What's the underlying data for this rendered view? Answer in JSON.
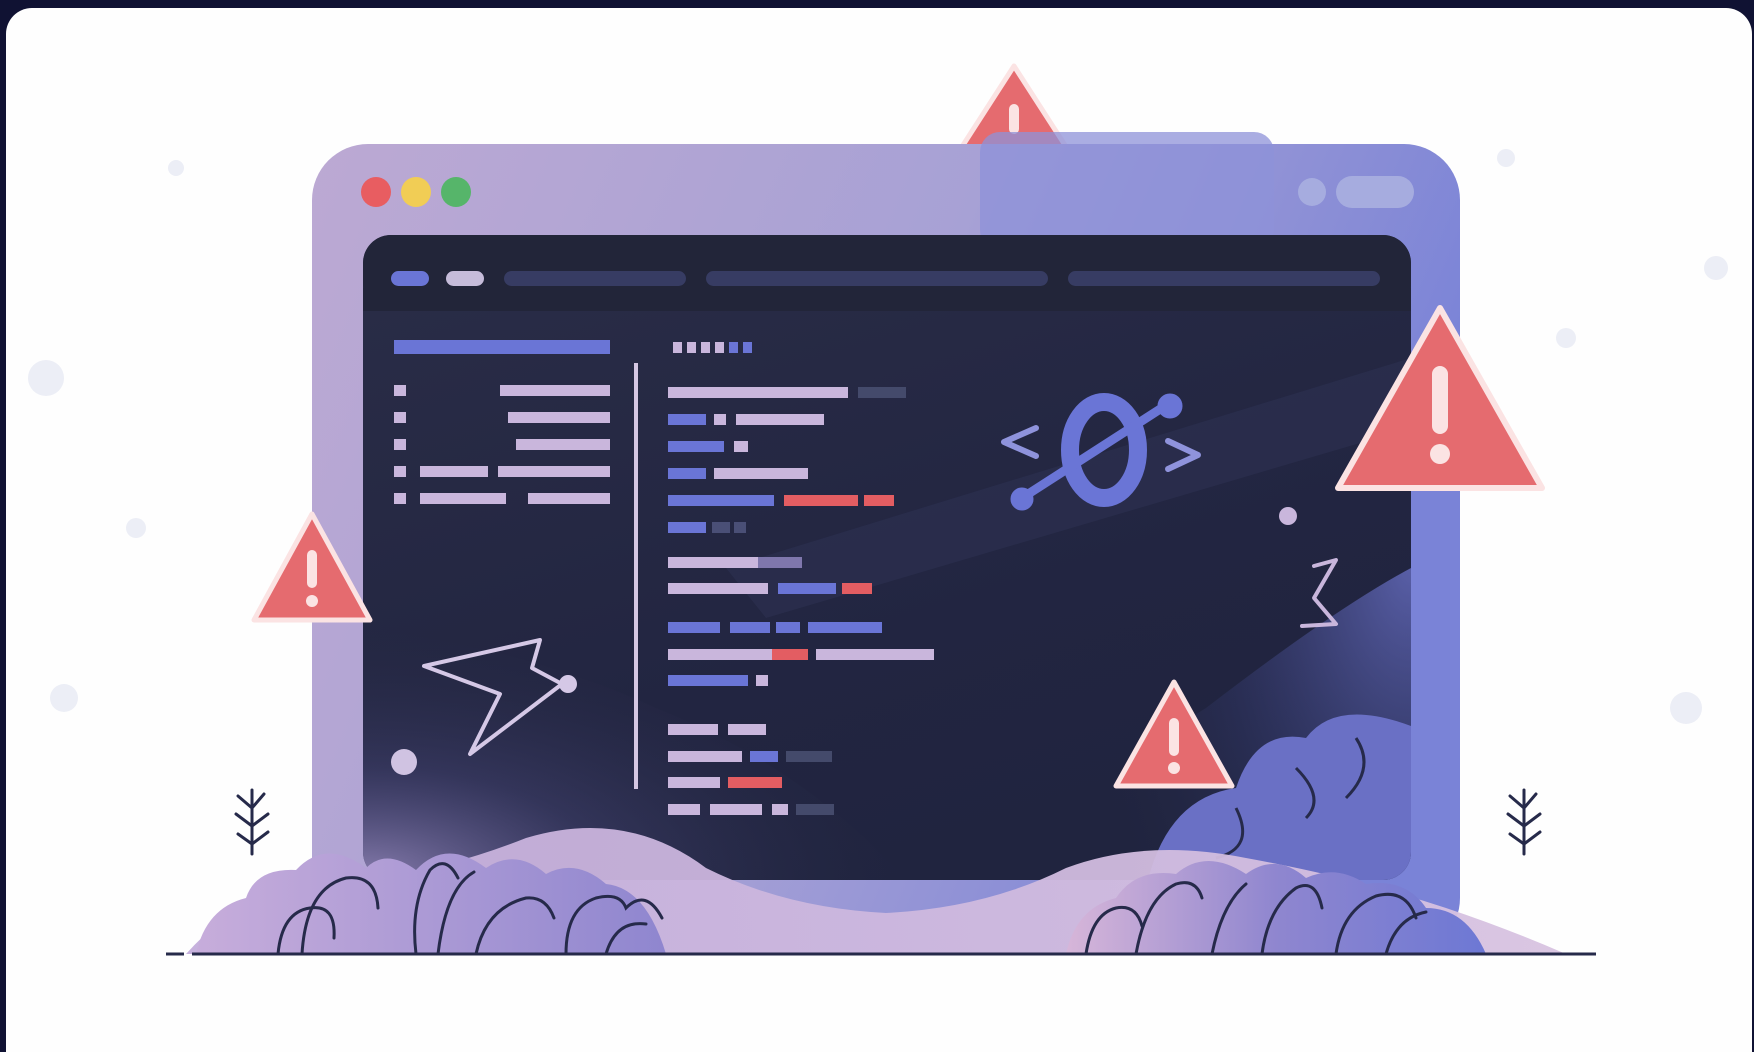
{
  "illustration": {
    "subject": "browser-window-with-code-errors",
    "icons": [
      "warning-icon",
      "code-bracket-icon",
      "lightning-bolt-icon",
      "zigzag-icon",
      "sprout-icon"
    ]
  },
  "colors": {
    "frame_left": "#b7a6d3",
    "frame_right": "#7f86d6",
    "screen": "#252842",
    "screen_glow": "#4a5294",
    "warning_fill": "#e56b6f",
    "warning_stroke": "#fbe3e3",
    "code_blue": "#6c78d8",
    "code_lilac": "#c9b6dc",
    "code_red": "#e35d62",
    "dot_red": "#e85d61",
    "dot_yellow": "#f1cd55",
    "dot_green": "#56b56a",
    "ink": "#262a4a"
  }
}
